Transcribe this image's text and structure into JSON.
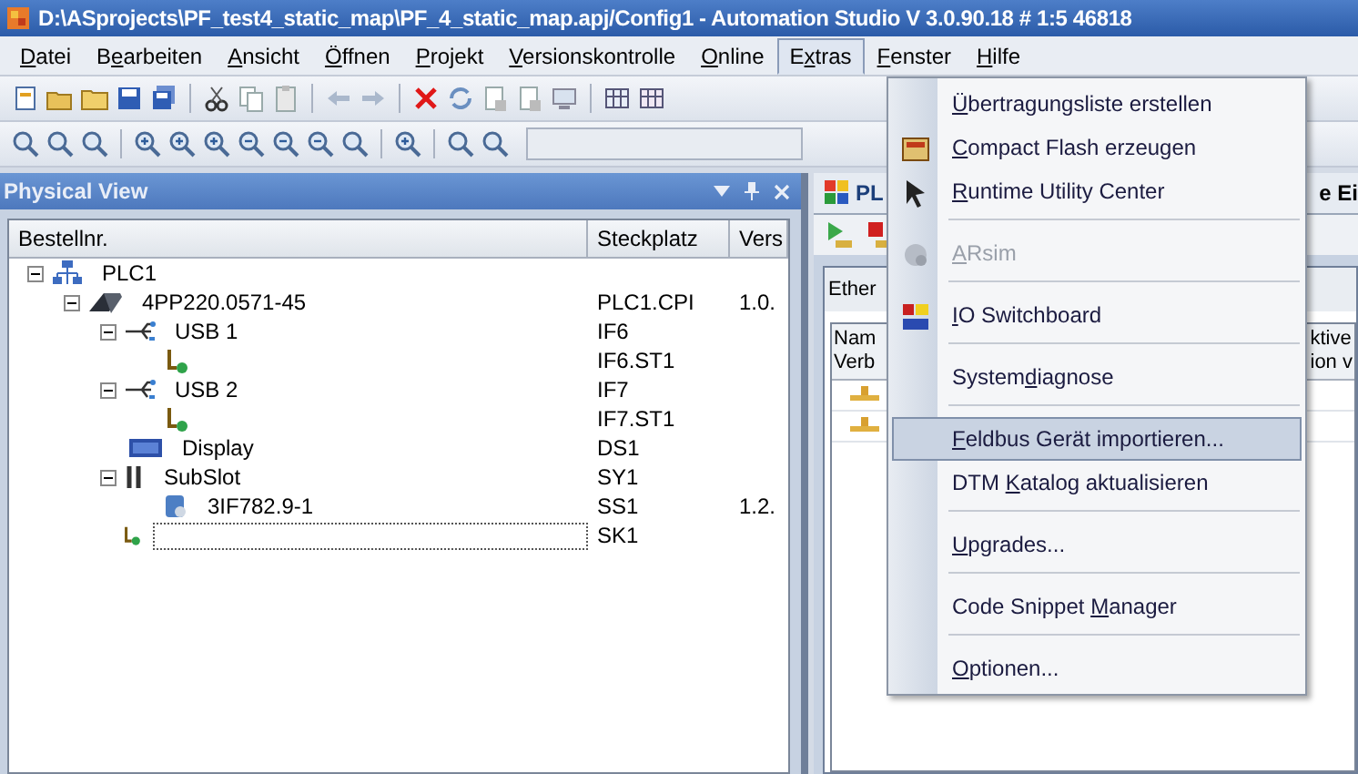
{
  "window": {
    "title": "D:\\ASprojects\\PF_test4_static_map\\PF_4_static_map.apj/Config1 - Automation Studio V 3.0.90.18 # 1:5 46818"
  },
  "menubar": [
    {
      "key": "D",
      "after": "atei",
      "selected": false
    },
    {
      "before": "B",
      "key": "e",
      "after": "arbeiten",
      "selected": false
    },
    {
      "key": "A",
      "after": "nsicht",
      "selected": false
    },
    {
      "key": "Ö",
      "after": "ffnen",
      "selected": false
    },
    {
      "key": "P",
      "after": "rojekt",
      "selected": false
    },
    {
      "key": "V",
      "after": "ersionskontrolle",
      "selected": false
    },
    {
      "key": "O",
      "after": "nline",
      "selected": false
    },
    {
      "before": "E",
      "key": "x",
      "after": "tras",
      "selected": true
    },
    {
      "key": "F",
      "after": "enster",
      "selected": false
    },
    {
      "key": "H",
      "after": "ilfe",
      "selected": false
    }
  ],
  "physical_view": {
    "title": "Physical View",
    "columns": [
      "Bestellnr.",
      "Steckplatz",
      "Vers"
    ],
    "tree": [
      {
        "kind": "plc",
        "label": "PLC1",
        "expanded": true,
        "children": [
          {
            "kind": "cpu",
            "label": "4PP220.0571-45",
            "slot": "PLC1.CPI",
            "version": "1.0.",
            "expanded": true,
            "children": [
              {
                "kind": "usb",
                "label": "USB 1",
                "slot": "IF6",
                "expanded": true,
                "children": [
                  {
                    "kind": "station",
                    "slot": "IF6.ST1"
                  }
                ]
              },
              {
                "kind": "usb",
                "label": "USB 2",
                "slot": "IF7",
                "expanded": true,
                "children": [
                  {
                    "kind": "station",
                    "slot": "IF7.ST1"
                  }
                ]
              },
              {
                "kind": "display",
                "label": "Display",
                "slot": "DS1"
              },
              {
                "kind": "subslot",
                "label": "SubSlot",
                "slot": "SY1",
                "expanded": true,
                "children": [
                  {
                    "kind": "module",
                    "label": "3IF782.9-1",
                    "slot": "SS1",
                    "version": "1.2."
                  }
                ]
              },
              {
                "kind": "station",
                "slot": "SK1",
                "editing": true
              }
            ]
          }
        ]
      }
    ]
  },
  "right_pane": {
    "tab_left": "PL",
    "tab_right": "e Ei",
    "inner_tab": "Ether",
    "header_left": [
      "Nam",
      "Verb"
    ],
    "header_right": [
      "ktive",
      "ion v"
    ]
  },
  "extras_menu": [
    {
      "key": "Ü",
      "after": "bertragungsliste erstellen",
      "icon": false,
      "disabled": false,
      "selected": false,
      "separator_after": false
    },
    {
      "key": "C",
      "after": "ompact Flash erzeugen",
      "icon": true,
      "disabled": false,
      "selected": false,
      "separator_after": false
    },
    {
      "key": "R",
      "after": "untime Utility Center",
      "icon": true,
      "disabled": false,
      "selected": false,
      "separator_after": true
    },
    {
      "key": "A",
      "after": "Rsim",
      "icon": true,
      "disabled": true,
      "selected": false,
      "separator_after": true
    },
    {
      "key": "I",
      "after": "O Switchboard",
      "icon": true,
      "disabled": false,
      "selected": false,
      "separator_after": true
    },
    {
      "before": "System",
      "key": "d",
      "after": "iagnose",
      "icon": false,
      "disabled": false,
      "selected": false,
      "separator_after": true
    },
    {
      "key": "F",
      "after": "eldbus Gerät importieren...",
      "icon": false,
      "disabled": false,
      "selected": true,
      "separator_after": false
    },
    {
      "before": "DTM ",
      "key": "K",
      "after": "atalog aktualisieren",
      "icon": false,
      "disabled": false,
      "selected": false,
      "separator_after": true
    },
    {
      "key": "U",
      "after": "pgrades...",
      "icon": false,
      "disabled": false,
      "selected": false,
      "separator_after": true
    },
    {
      "before": "Code Snippet ",
      "key": "M",
      "after": "anager",
      "icon": false,
      "disabled": false,
      "selected": false,
      "separator_after": true
    },
    {
      "key": "O",
      "after": "ptionen...",
      "icon": false,
      "disabled": false,
      "selected": false,
      "separator_after": false
    }
  ]
}
